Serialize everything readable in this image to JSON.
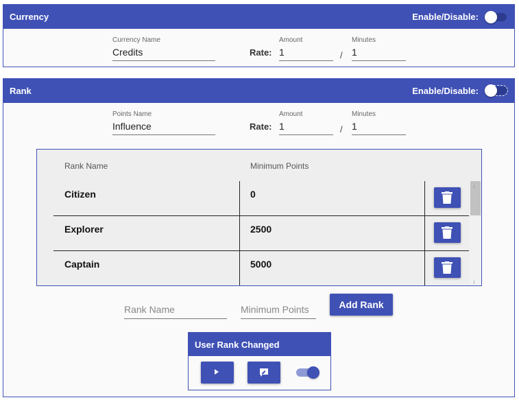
{
  "currency": {
    "title": "Currency",
    "enable_label": "Enable/Disable:",
    "enabled": false,
    "name_label": "Currency Name",
    "name_value": "Credits",
    "rate_label": "Rate:",
    "amount_label": "Amount",
    "amount_value": "1",
    "slash": "/",
    "minutes_label": "Minutes",
    "minutes_value": "1"
  },
  "rank": {
    "title": "Rank",
    "enable_label": "Enable/Disable:",
    "enabled": false,
    "name_label": "Points Name",
    "name_value": "Influence",
    "rate_label": "Rate:",
    "amount_label": "Amount",
    "amount_value": "1",
    "slash": "/",
    "minutes_label": "Minutes",
    "minutes_value": "1",
    "table": {
      "headers": [
        "Rank Name",
        "Minimum Points"
      ],
      "rows": [
        {
          "name": "Citizen",
          "min": "0"
        },
        {
          "name": "Explorer",
          "min": "2500"
        },
        {
          "name": "Captain",
          "min": "5000"
        }
      ],
      "delete_icon": "trash-icon"
    },
    "add": {
      "rank_name_placeholder": "Rank Name",
      "min_points_placeholder": "Minimum Points",
      "button_label": "Add Rank"
    },
    "event": {
      "title": "User Rank Changed",
      "play_icon": "play-icon",
      "edit_icon": "chat-edit-icon",
      "enabled": true
    }
  },
  "colors": {
    "primary": "#3f51b5",
    "background": "#fafafa",
    "table_bg": "#eeeeee"
  }
}
